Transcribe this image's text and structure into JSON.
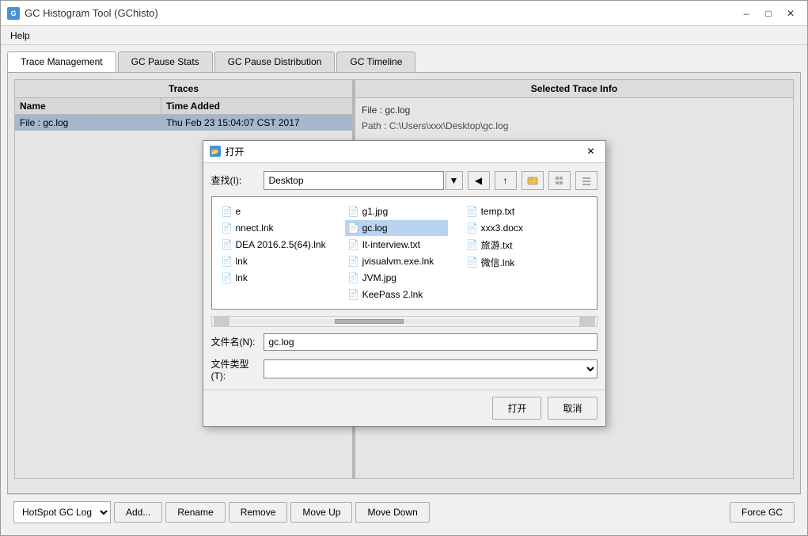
{
  "window": {
    "title": "GC Histogram Tool (GChisto)",
    "icon": "G"
  },
  "menu": {
    "items": [
      "Help"
    ]
  },
  "tabs": [
    {
      "id": "trace-management",
      "label": "Trace Management",
      "active": true
    },
    {
      "id": "gc-pause-stats",
      "label": "GC Pause Stats",
      "active": false
    },
    {
      "id": "gc-pause-distribution",
      "label": "GC Pause Distribution",
      "active": false
    },
    {
      "id": "gc-timeline",
      "label": "GC Timeline",
      "active": false
    }
  ],
  "traces_panel": {
    "header": "Traces",
    "columns": [
      "Name",
      "Time Added"
    ],
    "rows": [
      {
        "name": "File : gc.log",
        "time": "Thu Feb 23 15:04:07 CST 2017"
      }
    ]
  },
  "selected_trace": {
    "header": "Selected Trace Info",
    "info_line1": "File : gc.log",
    "info_line2": "Path : C:\\Users\\xxx\\Desktop\\gc.log"
  },
  "bottom_bar": {
    "gc_types": [
      "HotSpot GC Log"
    ],
    "selected_gc": "HotSpot GC Log",
    "buttons": {
      "add": "Add...",
      "rename": "Rename",
      "remove": "Remove",
      "move_up": "Move Up",
      "move_down": "Move Down",
      "force_gc": "Force GC"
    }
  },
  "dialog": {
    "title": "打开",
    "lookup_label": "查找(I):",
    "lookup_value": "Desktop",
    "filename_label": "文件名(N):",
    "filename_value": "gc.log",
    "filetype_label": "文件类型(T):",
    "filetype_value": "",
    "open_btn": "打开",
    "cancel_btn": "取消",
    "files_left": [
      {
        "name": "e",
        "type": "doc"
      },
      {
        "name": "nnect.lnk",
        "type": "doc"
      },
      {
        "name": "DEA 2016.2.5(64).lnk",
        "type": "doc"
      },
      {
        "name": "lnk",
        "type": "doc"
      },
      {
        "name": "lnk",
        "type": "doc"
      }
    ],
    "files_right": [
      {
        "name": "g1.jpg",
        "type": "doc"
      },
      {
        "name": "gc.log",
        "type": "doc",
        "selected": true
      },
      {
        "name": "It-interview.txt",
        "type": "doc"
      },
      {
        "name": "jvisualvm.exe.lnk",
        "type": "doc"
      },
      {
        "name": "JVM.jpg",
        "type": "doc"
      },
      {
        "name": "KeePass 2.lnk",
        "type": "doc"
      }
    ],
    "files_far_right": [
      {
        "name": "temp.txt",
        "type": "doc"
      },
      {
        "name": "xxx3.docx",
        "type": "doc"
      },
      {
        "name": "旅游.txt",
        "type": "doc"
      },
      {
        "name": "微信.lnk",
        "type": "doc"
      }
    ],
    "toolbar_buttons": [
      "back",
      "up-folder",
      "new-folder",
      "list-view",
      "detail-view"
    ]
  }
}
